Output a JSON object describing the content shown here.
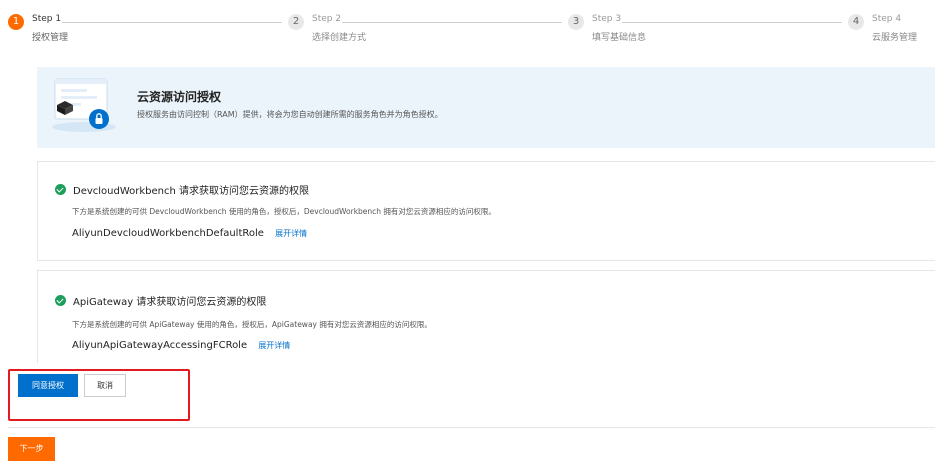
{
  "steps": [
    {
      "num": "1",
      "title": "Step 1",
      "sub": "授权管理",
      "state": "active"
    },
    {
      "num": "2",
      "title": "Step 2",
      "sub": "选择创建方式",
      "state": "todo"
    },
    {
      "num": "3",
      "title": "Step 3",
      "sub": "填写基础信息",
      "state": "todo"
    },
    {
      "num": "4",
      "title": "Step 4",
      "sub": "云服务管理",
      "state": "todo"
    }
  ],
  "banner": {
    "title": "云资源访问授权",
    "desc": "授权服务由访问控制（RAM）提供，将会为您自动创建所需的服务角色并为角色授权。"
  },
  "cards": [
    {
      "heading": "DevcloudWorkbench 请求获取访问您云资源的权限",
      "desc": "下方是系统创建的可供 DevcloudWorkbench 使用的角色，授权后，DevcloudWorkbench 拥有对您云资源相应的访问权限。",
      "role": "AliyunDevcloudWorkbenchDefaultRole",
      "link": "展开详情"
    },
    {
      "heading": "ApiGateway 请求获取访问您云资源的权限",
      "desc": "下方是系统创建的可供 ApiGateway 使用的角色，授权后，ApiGateway 拥有对您云资源相应的访问权限。",
      "role": "AliyunApiGatewayAccessingFCRole",
      "link": "展开详情"
    }
  ],
  "actions": {
    "agree": "同意授权",
    "cancel": "取消",
    "next": "下一步"
  },
  "colors": {
    "accent_orange": "#ff6a00",
    "primary_blue": "#0070cc",
    "success_green": "#1e9e5a",
    "highlight_red": "#e4191e"
  }
}
